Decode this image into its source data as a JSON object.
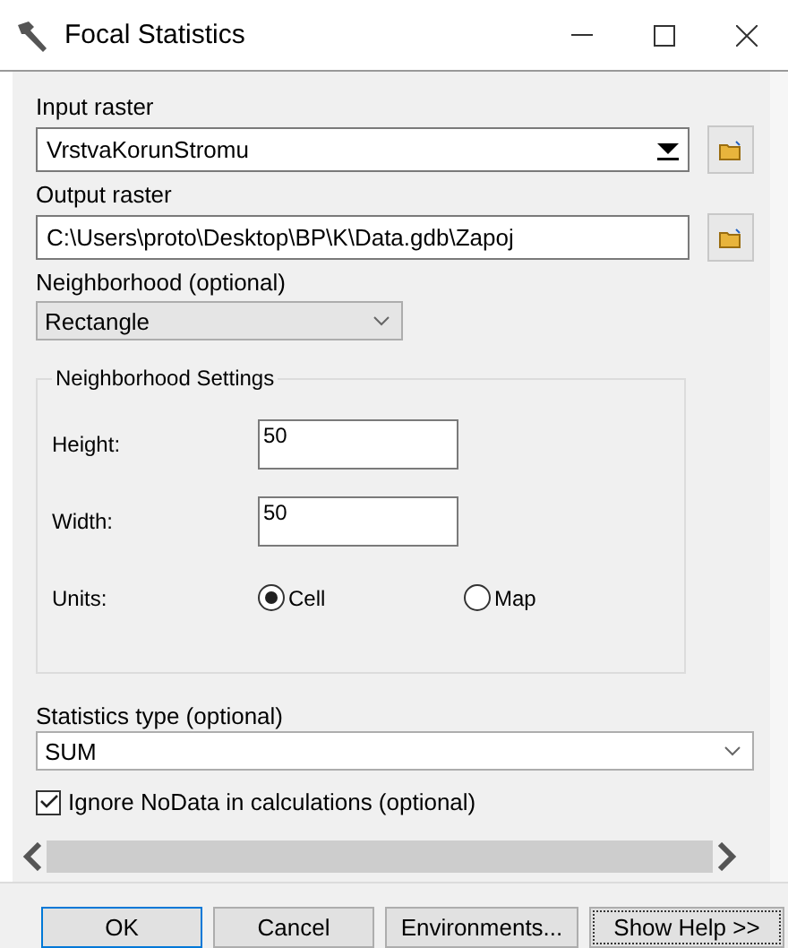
{
  "window": {
    "title": "Focal Statistics"
  },
  "fields": [
    {
      "kind": "combo",
      "label": "Input raster",
      "value": "VrstvaKorunStromu"
    },
    {
      "kind": "text",
      "label": "Output raster",
      "value": "C:\\Users\\proto\\Desktop\\BP\\K\\Data.gdb\\Zapoj"
    }
  ],
  "neighborhood": {
    "label": "Neighborhood (optional)",
    "value": "Rectangle"
  },
  "neighborhood_settings": {
    "title": "Neighborhood Settings",
    "height": {
      "label": "Height:",
      "value": "50"
    },
    "width": {
      "label": "Width:",
      "value": "50"
    },
    "units": {
      "label": "Units:",
      "options": [
        {
          "label": "Cell",
          "selected": true
        },
        {
          "label": "Map",
          "selected": false
        }
      ]
    }
  },
  "statistics_type": {
    "label": "Statistics type (optional)",
    "value": "SUM"
  },
  "ignore_nodata": {
    "label": "Ignore NoData in calculations (optional)",
    "checked": true
  },
  "buttons": [
    {
      "label": "OK",
      "kind": "default"
    },
    {
      "label": "Cancel",
      "kind": "normal"
    },
    {
      "label": "Environments...",
      "kind": "normal"
    },
    {
      "label": "Show Help >>",
      "kind": "focused"
    }
  ]
}
